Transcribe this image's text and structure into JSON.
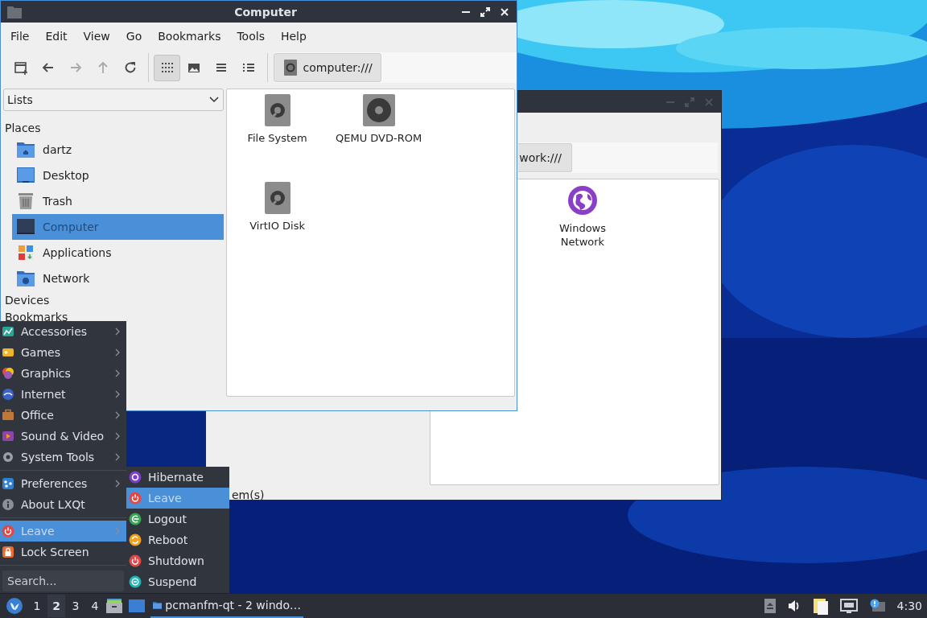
{
  "back_window": {
    "location": "work:///",
    "files": [
      {
        "label": "Windows Network"
      }
    ],
    "status": "em(s)"
  },
  "window": {
    "title": "Computer",
    "menu": [
      "File",
      "Edit",
      "View",
      "Go",
      "Bookmarks",
      "Tools",
      "Help"
    ],
    "toolbar": [
      {
        "disabled": false
      },
      {
        "disabled": false
      },
      {
        "disabled": true
      },
      {
        "disabled": true
      },
      {
        "disabled": false
      }
    ],
    "view_modes": [
      {
        "selected": true
      },
      {
        "selected": false
      },
      {
        "selected": false
      },
      {
        "selected": false
      }
    ],
    "location": "computer:///",
    "side_pane": {
      "mode": "Lists",
      "sections": [
        {
          "title": "Places",
          "items": [
            {
              "label": "dartz",
              "selected": false
            },
            {
              "label": "Desktop",
              "selected": false
            },
            {
              "label": "Trash",
              "selected": false
            },
            {
              "label": "Computer",
              "selected": true
            },
            {
              "label": "Applications",
              "selected": false
            },
            {
              "label": "Network",
              "selected": false
            }
          ]
        },
        {
          "title": "Devices"
        },
        {
          "title": "Bookmarks"
        }
      ]
    },
    "files": [
      {
        "label": "File System"
      },
      {
        "label": "QEMU DVD-ROM"
      },
      {
        "label": "VirtIO Disk"
      }
    ]
  },
  "main_menu": {
    "items": [
      {
        "kind": "submenu",
        "label": "Accessories",
        "selected": false
      },
      {
        "kind": "submenu",
        "label": "Games",
        "selected": false
      },
      {
        "kind": "submenu",
        "label": "Graphics",
        "selected": false
      },
      {
        "kind": "submenu",
        "label": "Internet",
        "selected": false
      },
      {
        "kind": "submenu",
        "label": "Office",
        "selected": false
      },
      {
        "kind": "submenu",
        "label": "Sound & Video",
        "selected": false
      },
      {
        "kind": "submenu",
        "label": "System Tools",
        "selected": false
      },
      {
        "kind": "separator"
      },
      {
        "kind": "submenu",
        "label": "Preferences",
        "selected": false
      },
      {
        "kind": "action",
        "label": "About LXQt",
        "selected": false
      },
      {
        "kind": "separator"
      },
      {
        "kind": "submenu",
        "label": "Leave",
        "selected": true
      },
      {
        "kind": "action",
        "label": "Lock Screen",
        "selected": false
      },
      {
        "kind": "separator"
      }
    ],
    "search": {
      "placeholder": "Search..."
    }
  },
  "leave_menu": {
    "items": [
      {
        "label": "Hibernate",
        "selected": false
      },
      {
        "label": "Leave",
        "selected": true
      },
      {
        "label": "Logout",
        "selected": false
      },
      {
        "label": "Reboot",
        "selected": false
      },
      {
        "label": "Shutdown",
        "selected": false
      },
      {
        "label": "Suspend",
        "selected": false
      }
    ]
  },
  "taskbar": {
    "desktops": [
      {
        "label": "1",
        "selected": false
      },
      {
        "label": "2",
        "selected": true
      },
      {
        "label": "3",
        "selected": false
      },
      {
        "label": "4",
        "selected": false
      }
    ],
    "tasks": [
      {
        "label": "pcmanfm-qt - 2 windo…",
        "active": true
      }
    ],
    "clock": "4:30"
  }
}
